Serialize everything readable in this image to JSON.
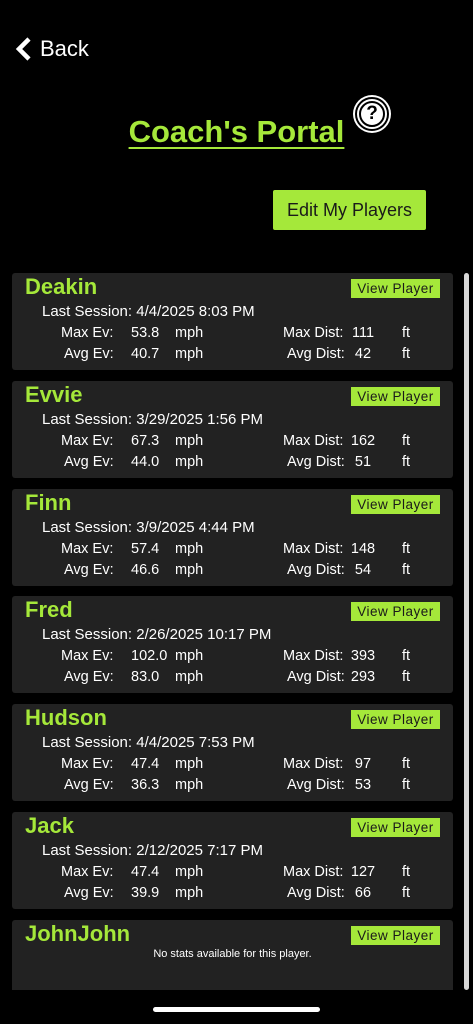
{
  "header": {
    "back_label": "Back",
    "title": "Coach's Portal",
    "help_label": "?"
  },
  "actions": {
    "edit_players": "Edit My Players"
  },
  "labels": {
    "view_player": "View Player",
    "last_session": "Last Session:",
    "max_ev": "Max Ev:",
    "avg_ev": "Avg Ev:",
    "max_dist": "Max Dist:",
    "avg_dist": "Avg Dist:",
    "mph": "mph",
    "ft": "ft",
    "no_stats": "No stats available for this player."
  },
  "players": [
    {
      "name": "Deakin",
      "last_session": "4/4/2025 8:03 PM",
      "max_ev": "53.8",
      "avg_ev": "40.7",
      "max_dist": "111",
      "avg_dist": "42"
    },
    {
      "name": "Evvie",
      "last_session": "3/29/2025 1:56 PM",
      "max_ev": "67.3",
      "avg_ev": "44.0",
      "max_dist": "162",
      "avg_dist": "51"
    },
    {
      "name": "Finn",
      "last_session": "3/9/2025 4:44 PM",
      "max_ev": "57.4",
      "avg_ev": "46.6",
      "max_dist": "148",
      "avg_dist": "54"
    },
    {
      "name": "Fred",
      "last_session": "2/26/2025 10:17 PM",
      "max_ev": "102.0",
      "avg_ev": "83.0",
      "max_dist": "393",
      "avg_dist": "293"
    },
    {
      "name": "Hudson",
      "last_session": "4/4/2025 7:53 PM",
      "max_ev": "47.4",
      "avg_ev": "36.3",
      "max_dist": "97",
      "avg_dist": "53"
    },
    {
      "name": "Jack",
      "last_session": "2/12/2025 7:17 PM",
      "max_ev": "47.4",
      "avg_ev": "39.9",
      "max_dist": "127",
      "avg_dist": "66"
    },
    {
      "name": "JohnJohn",
      "no_stats": true
    }
  ]
}
